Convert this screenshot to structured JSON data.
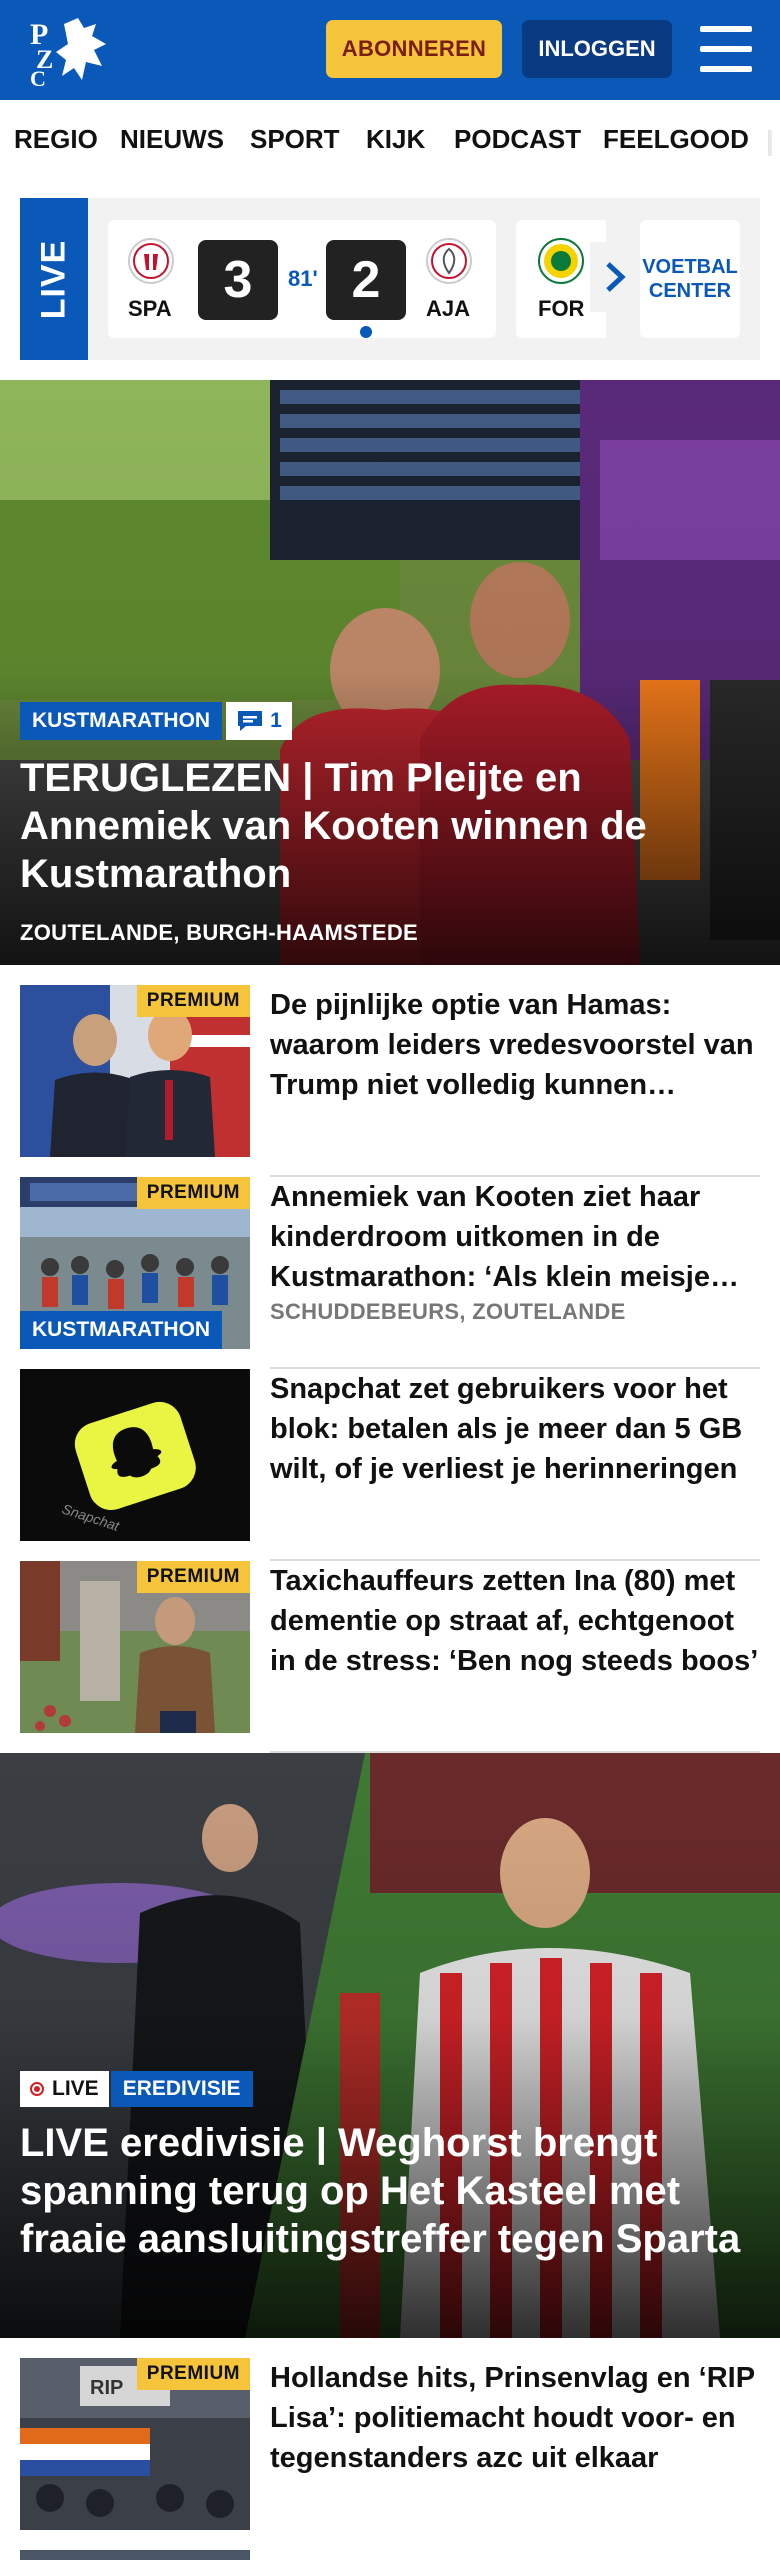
{
  "header": {
    "logo_text": "PZC",
    "subscribe_label": "ABONNEREN",
    "login_label": "INLOGGEN",
    "menu_icon": "hamburger-menu-icon",
    "brand_color": "#0a58b8",
    "accent_color": "#f5c43a"
  },
  "nav": {
    "items": [
      "REGIO",
      "NIEUWS",
      "SPORT",
      "KIJK",
      "PODCAST",
      "FEELGOOD"
    ]
  },
  "live_widget": {
    "label": "LIVE",
    "match": {
      "home_code": "SPA",
      "away_code": "AJA",
      "home_score": "3",
      "away_score": "2",
      "minute": "81'"
    },
    "next_match_code": "FOR",
    "next_icon": "chevron-right-icon",
    "voetbal_center_line1": "VOETBAL",
    "voetbal_center_line2": "CENTER"
  },
  "hero": {
    "tag": "KUSTMARATHON",
    "comment_count": "1",
    "comment_icon": "comment-icon",
    "title": "TERUGLEZEN | Tim Pleijte en Annemiek van Kooten winnen de Kustmarathon",
    "location": "ZOUTELANDE, BURGH-HAAMSTEDE"
  },
  "articles": [
    {
      "premium": "PREMIUM",
      "title": "De pijnlijke optie van Hamas: waarom leiders vredesvoorstel van Trump niet volledig kunnen afwijzen",
      "location": "",
      "tag": ""
    },
    {
      "premium": "PREMIUM",
      "title": "Annemiek van Kooten ziet haar kinderdroom uitkomen in de Kustmarathon: ‘Als klein meisje stond ik hier al’",
      "location": "SCHUDDEBEURS, ZOUTELANDE",
      "tag": "KUSTMARATHON"
    },
    {
      "premium": "",
      "title": "Snapchat zet gebruikers voor het blok: betalen als je meer dan 5 GB wilt, of je verliest je herinneringen",
      "location": "",
      "tag": ""
    },
    {
      "premium": "PREMIUM",
      "title": "Taxichauffeurs zetten Ina (80) met dementie op straat af, echtgenoot in de stress: ‘Ben nog steeds boos’",
      "location": "",
      "tag": ""
    }
  ],
  "feature": {
    "live_label": "LIVE",
    "tag": "EREDIVISIE",
    "title": "LIVE eredivisie | Weghorst brengt spanning terug op Het Kasteel met fraaie aansluitingstreffer tegen Sparta"
  },
  "article_bottom": {
    "premium": "PREMIUM",
    "title": "Hollandse hits, Prinsenvlag en ‘RIP Lisa’: politiemacht houdt voor- en tegenstanders azc uit elkaar"
  }
}
